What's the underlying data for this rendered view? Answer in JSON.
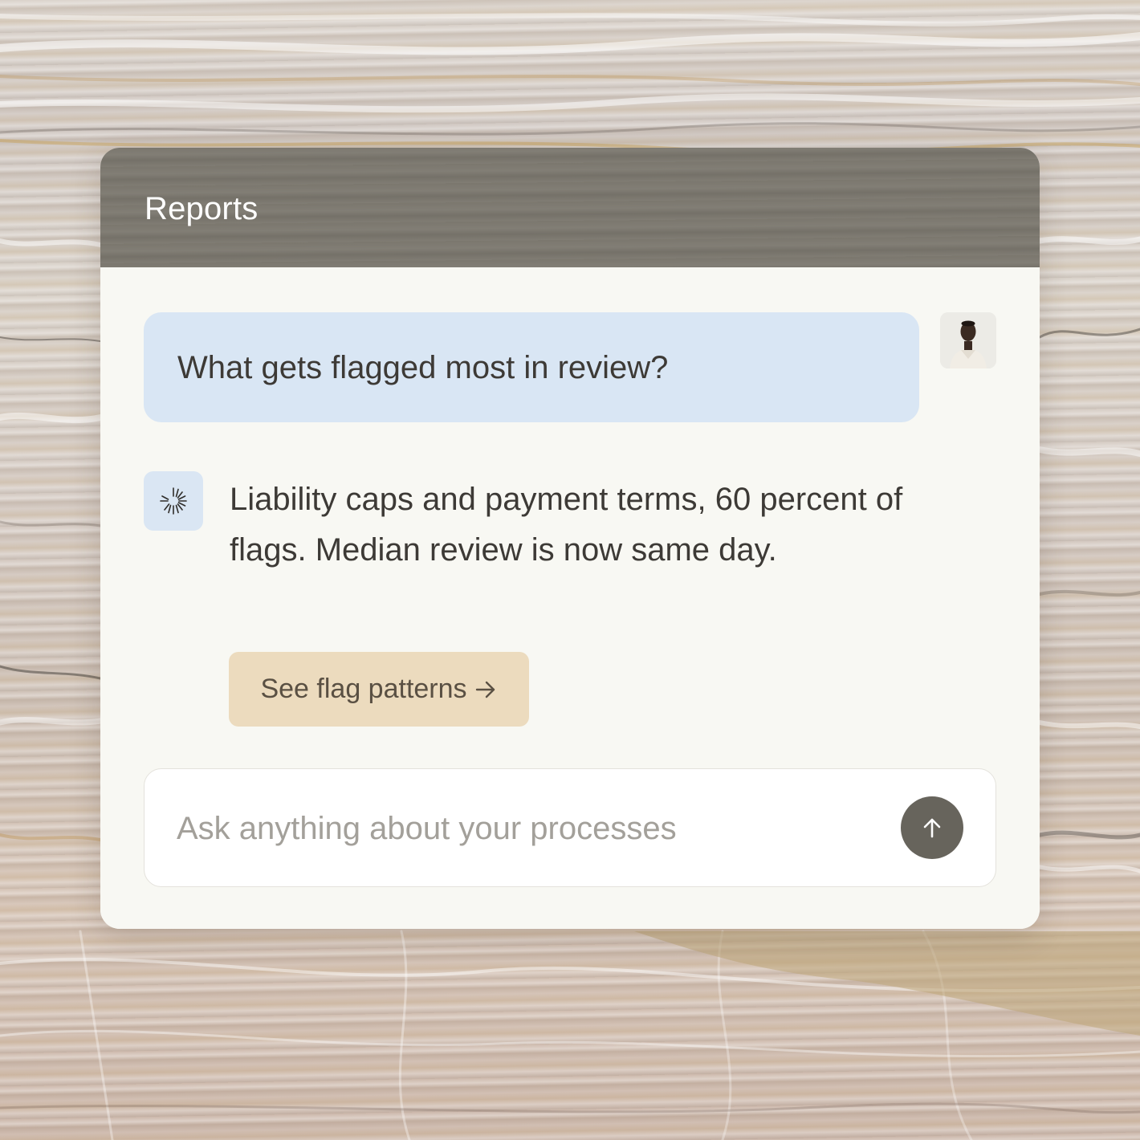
{
  "app": {
    "title": "Reports"
  },
  "conversation": {
    "user_message": "What gets flagged most in review?",
    "user_avatar_icon": "user-avatar-photo",
    "assistant_icon": "sparkle-burst-icon",
    "assistant_message": "Liability caps and payment terms, 60 percent of flags. Median review is now same day.",
    "action_button": {
      "label": "See flag patterns",
      "icon": "arrow-right-icon"
    }
  },
  "composer": {
    "placeholder": "Ask anything about your processes",
    "value": "",
    "send_icon": "arrow-up-icon"
  },
  "colors": {
    "header_bg": "#7b776e",
    "card_bg": "#f8f8f3",
    "user_bubble_bg": "#d9e6f4",
    "action_button_bg": "#ecdbbe",
    "send_button_bg": "#67645c",
    "text_primary": "#3d3a36",
    "placeholder_text": "#a3a09a"
  }
}
